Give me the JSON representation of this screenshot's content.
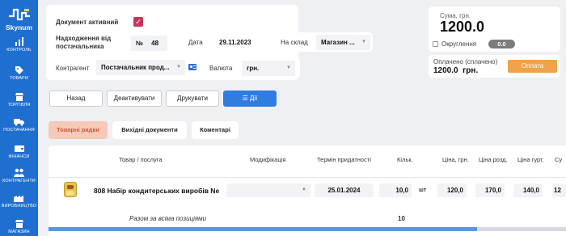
{
  "app": {
    "name": "Skynum"
  },
  "sidebar": {
    "items": [
      {
        "label": "КОНТРОЛЬ",
        "icon": "chart-icon"
      },
      {
        "label": "ТОВАРИ",
        "icon": "tag-icon"
      },
      {
        "label": "ТОРГІВЛЯ",
        "icon": "store-icon"
      },
      {
        "label": "ПОСТАЧАННЯ",
        "icon": "truck-icon"
      },
      {
        "label": "ФІНАНСИ",
        "icon": "wallet-icon"
      },
      {
        "label": "КОНТРАГЕНТИ",
        "icon": "users-icon"
      },
      {
        "label": "ВИРОБНИЦТВО",
        "icon": "factory-icon"
      },
      {
        "label": "МАГАЗИН",
        "icon": "shop-icon"
      }
    ]
  },
  "doc": {
    "active_label": "Документ активний",
    "income_label": "Надходження від постачальника",
    "number_prefix": "№",
    "number": "48",
    "date_label": "Дата",
    "date": "29.11.2023",
    "warehouse_label": "На склад",
    "warehouse": "Магазин ...",
    "counterparty_label": "Контрагент",
    "counterparty": "Постачальник прод...",
    "currency_label": "Валюта",
    "currency": "грн."
  },
  "summary": {
    "sum_label": "Сума, грн.",
    "sum": "1200.0",
    "rounding_label": "Округлення",
    "rounding_value": "0.0",
    "paid_label": "Оплачено (сплачено)",
    "paid": "1200.0  грн.",
    "pay_button": "Оплата",
    "pay_color": "#f0a24a"
  },
  "actions": {
    "back": "Назад",
    "deactivate": "Деактивувати",
    "print": "Друкувати",
    "actions": "Дії"
  },
  "tabs": [
    {
      "label": "Товарні рядки",
      "active": true
    },
    {
      "label": "Вихідні документи",
      "active": false
    },
    {
      "label": "Коментарі",
      "active": false
    }
  ],
  "table": {
    "headers": [
      "Товар / послуга",
      "Модифікація",
      "Термін придатності",
      "Кільк.",
      "Ціна, грн.",
      "Ціна розд.",
      "Ціна гурт.",
      "Су"
    ],
    "rows": [
      {
        "product": "808 Набір кондитерських виробів Ne",
        "modification": "",
        "expiry": "25.01.2024",
        "qty": "10,0",
        "unit": "шт",
        "price": "120,0",
        "retail": "170,0",
        "wholesale": "140,0",
        "sum_partial": "12"
      }
    ],
    "total_label": "Разом за всіма позиціями",
    "total_qty": "10"
  }
}
